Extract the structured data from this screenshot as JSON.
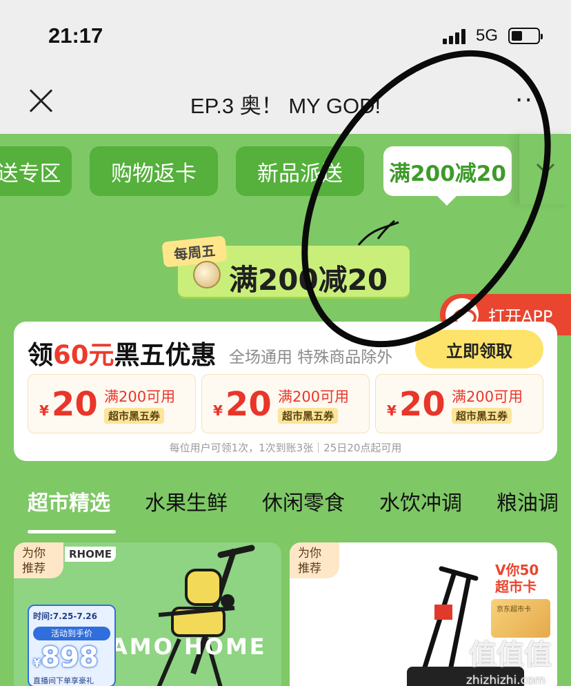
{
  "status_bar": {
    "time": "21:17",
    "network": "5G"
  },
  "nav": {
    "title": "EP.3 奥！ MY GOD!",
    "more": "···"
  },
  "categories": [
    {
      "label": "送专区"
    },
    {
      "label": "购物返卡"
    },
    {
      "label": "新品派送"
    },
    {
      "label": "满200减20",
      "active": true
    }
  ],
  "weekly_badge": {
    "tag": "每周五",
    "text": "满200减20"
  },
  "open_app": {
    "label": "打开APP"
  },
  "coupon_card": {
    "title_prefix": "领",
    "title_amount": "60元",
    "title_suffix": "黑五优惠",
    "subtitle": "全场通用 特殊商品除外",
    "claim_label": "立即领取",
    "coupons": [
      {
        "currency": "¥",
        "amount": "20",
        "condition": "满200可用",
        "type": "超市黑五券"
      },
      {
        "currency": "¥",
        "amount": "20",
        "condition": "满200可用",
        "type": "超市黑五券"
      },
      {
        "currency": "¥",
        "amount": "20",
        "condition": "满200可用",
        "type": "超市黑五券"
      }
    ],
    "footnote": "每位用户可领1次，1次到账3张｜25日20点起可用"
  },
  "tabs": [
    {
      "label": "超市精选",
      "active": true
    },
    {
      "label": "水果生鲜"
    },
    {
      "label": "休闲零食"
    },
    {
      "label": "水饮冲调"
    },
    {
      "label": "粮油调"
    }
  ],
  "products": [
    {
      "recommend": "为你\n推荐",
      "brand_top": "RHOME",
      "promo_time": "时间:7.25-7.26",
      "promo_label": "活动到手价",
      "price_currency": "¥",
      "price": "898",
      "promo_note": "直播间下单享豪礼",
      "brand_mid": "AMO HOME"
    },
    {
      "recommend": "为你\n推荐",
      "vcard_title": "V你50\n超市卡",
      "vcard_label": "京东超市卡",
      "watermark": "值值值",
      "watermark_url": "zhizhizhi.com"
    }
  ],
  "colors": {
    "page_green": "#7ec865",
    "pill_green": "#55b03c",
    "accent_red": "#ec3b2c",
    "claim_yellow": "#fde36a"
  },
  "icons": [
    "close-icon",
    "more-icon",
    "signal-icon",
    "battery-icon",
    "chevron-down-icon",
    "jd-logo-icon",
    "coin-icon"
  ]
}
